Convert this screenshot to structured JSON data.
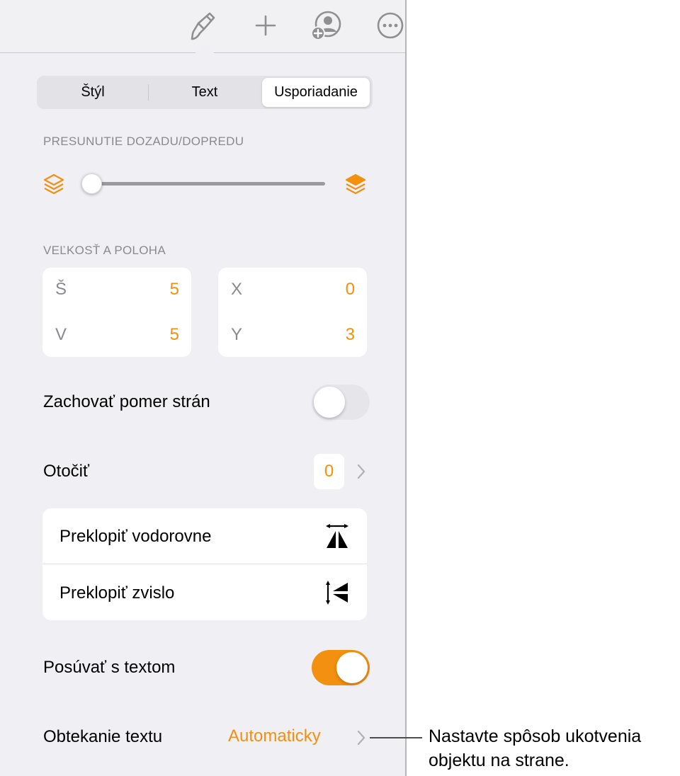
{
  "toolbar": {
    "icons": [
      "paintbrush-icon",
      "plus-icon",
      "add-collaborator-icon",
      "more-icon"
    ]
  },
  "tabs": [
    {
      "label": "Štýl",
      "active": false
    },
    {
      "label": "Text",
      "active": false
    },
    {
      "label": "Usporiadanie",
      "active": true
    }
  ],
  "arrange": {
    "section_title": "PRESUNUTIE DOZADU/DOPREDU",
    "slider_level": 0
  },
  "size_position": {
    "section_title": "VEĽKOSŤ A POLOHA",
    "width_label": "Š",
    "width_value": "5",
    "height_label": "V",
    "height_value": "5",
    "x_label": "X",
    "x_value": "0",
    "y_label": "Y",
    "y_value": "3"
  },
  "aspect": {
    "label": "Zachovať pomer strán",
    "on": false
  },
  "rotate": {
    "label": "Otočiť",
    "value": "0"
  },
  "flip": {
    "horizontal_label": "Preklopiť vodorovne",
    "vertical_label": "Preklopiť zvislo"
  },
  "move_with_text": {
    "label": "Posúvať s textom",
    "on": true
  },
  "text_wrap": {
    "label": "Obtekanie textu",
    "value": "Automaticky"
  },
  "callout": {
    "line1": "Nastavte spôsob ukotvenia",
    "line2": "objektu na strane."
  },
  "colors": {
    "accent": "#f2900f",
    "background": "#efeff4",
    "card": "#ffffff",
    "secondary_text": "#8a8a8e"
  }
}
